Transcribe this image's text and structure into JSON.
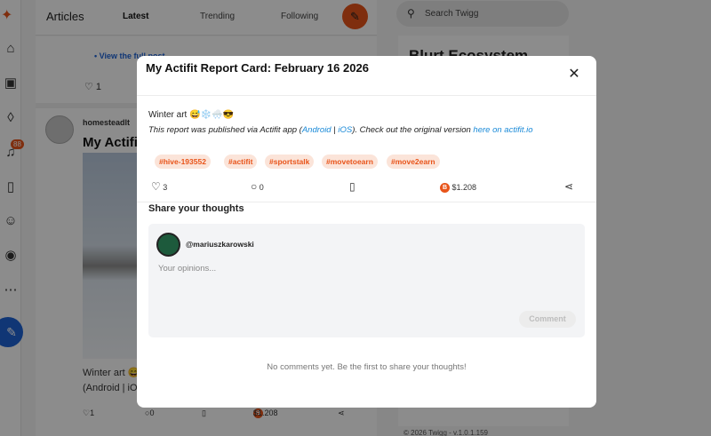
{
  "sidebar": {
    "badge": "88",
    "icons": [
      "logo-icon",
      "home-icon",
      "community-icon",
      "fire-icon",
      "bell-icon",
      "bookmark-icon",
      "people-icon",
      "profile-icon",
      "more-icon",
      "compose-icon"
    ]
  },
  "topbar": {
    "title": "Articles",
    "tabs": [
      "Latest",
      "Trending",
      "Following"
    ]
  },
  "feed": {
    "view_link": "View the full post",
    "post1_likes": "1",
    "post2": {
      "author": "homesteadlt",
      "title": "My Actifit Report Card: February 16 2026",
      "text1": "Winter art 😅❄️🌨️😎",
      "text2": "(Android | iOS). Check out the original version",
      "likes": "1",
      "comments": "0",
      "payout": "$1.208"
    }
  },
  "search": {
    "placeholder": "Search Twigg"
  },
  "right": {
    "card_title": "Blurt Ecosystem",
    "footer": "© 2026 Twigg - v.1.0.1.159"
  },
  "modal": {
    "title": "My Actifit Report Card: February 16 2026",
    "body_text": "Winter art 😅❄️🌨️😎",
    "note_prefix": "This report was published via Actifit app (",
    "note_android": "Android",
    "note_sep": " | ",
    "note_ios": "iOS",
    "note_mid": "). Check out the original version ",
    "note_link": "here on actifit.io",
    "tags": [
      "#hive-193552",
      "#actifit",
      "#sportstalk",
      "#movetoearn",
      "#move2earn"
    ],
    "likes": "3",
    "comments": "0",
    "payout": "$1.208",
    "share_title": "Share your thoughts",
    "username": "@mariuszkarowski",
    "comment_placeholder": "Your opinions...",
    "comment_button": "Comment",
    "empty_text": "No comments yet. Be the first to share your thoughts!"
  },
  "colors": {
    "accent": "#e8541a",
    "link": "#1a8ad8",
    "blue": "#1e63d6"
  }
}
